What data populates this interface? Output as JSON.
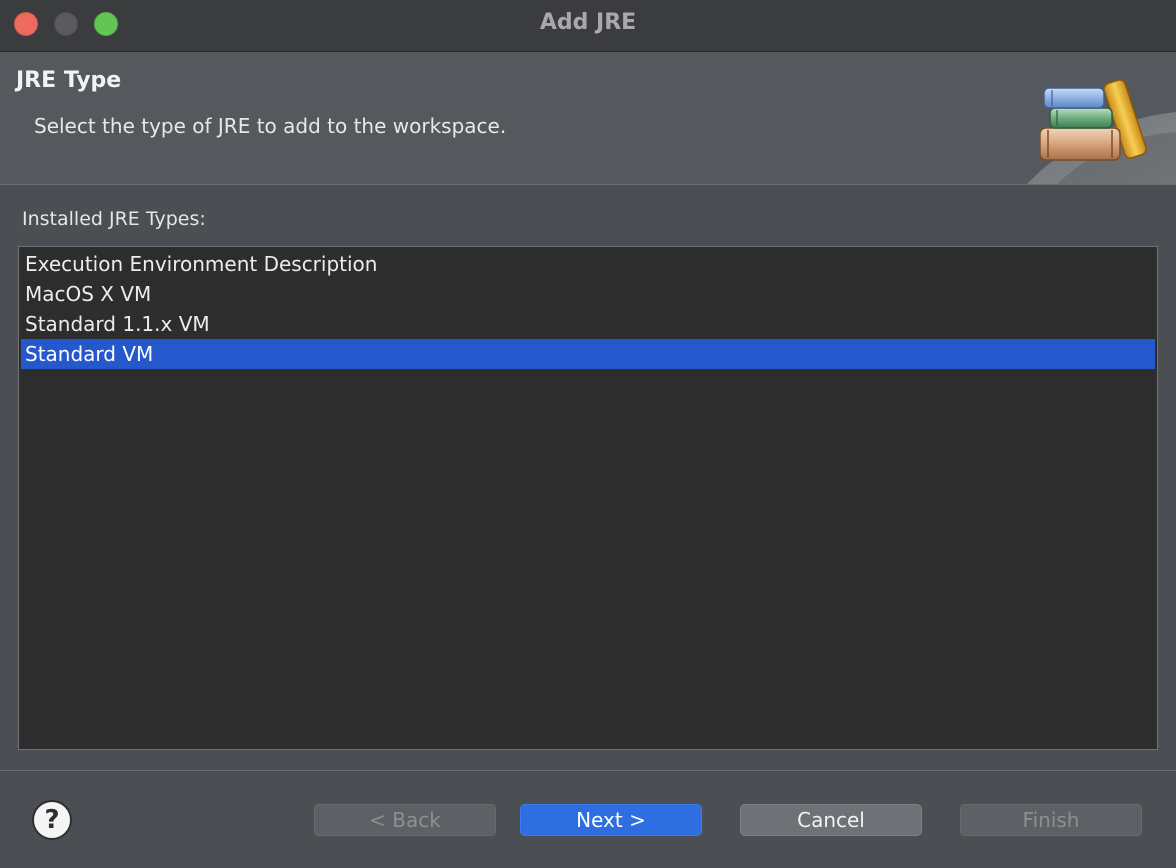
{
  "window": {
    "title": "Add JRE"
  },
  "banner": {
    "title": "JRE Type",
    "description": "Select the type of JRE to add to the workspace.",
    "graphic_icon": "jre-library-books-icon"
  },
  "content": {
    "list_label": "Installed JRE Types:",
    "items": [
      {
        "label": "Execution Environment Description",
        "selected": false
      },
      {
        "label": "MacOS X VM",
        "selected": false
      },
      {
        "label": "Standard 1.1.x VM",
        "selected": false
      },
      {
        "label": "Standard VM",
        "selected": true
      }
    ]
  },
  "footer": {
    "help_glyph": "?",
    "back_label": "< Back",
    "next_label": "Next >",
    "cancel_label": "Cancel",
    "finish_label": "Finish"
  },
  "colors": {
    "selection": "#2458cc",
    "primary_button": "#2f6ee0",
    "close": "#ed6a5e",
    "zoom": "#62c554"
  }
}
